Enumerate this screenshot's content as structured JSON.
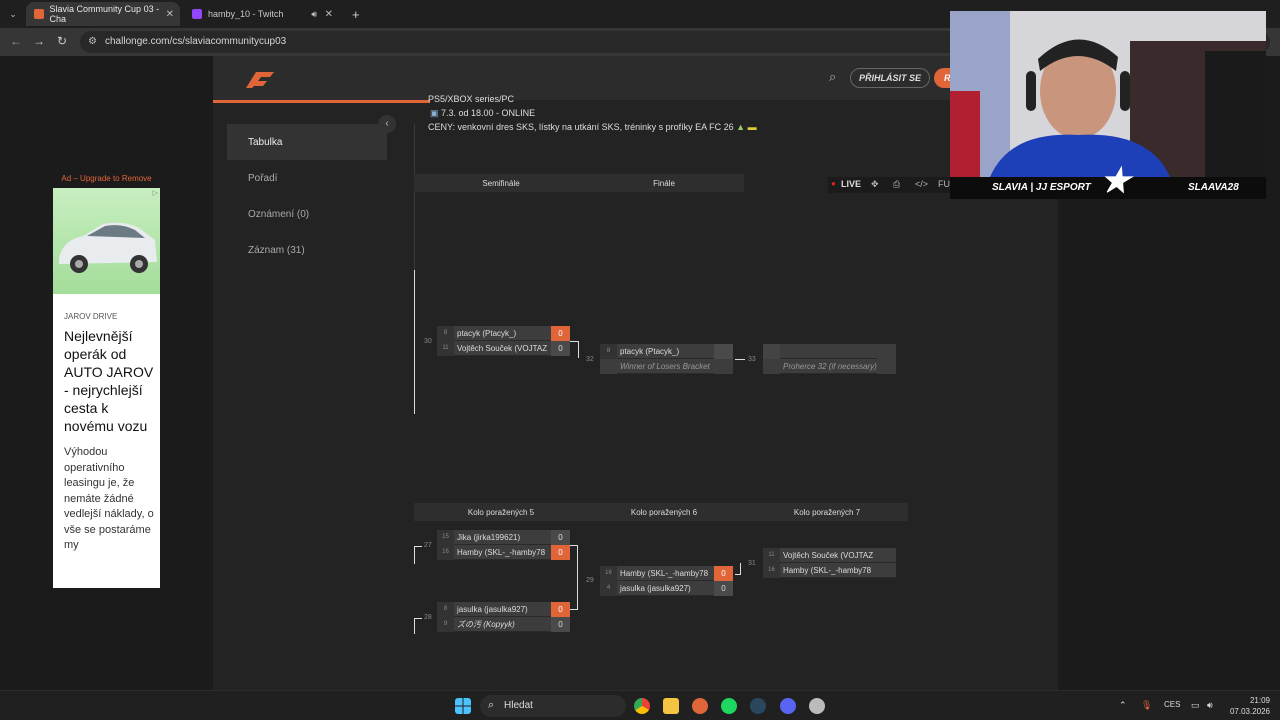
{
  "browser": {
    "tabs": [
      {
        "title": "Slavia Community Cup 03 - Cha"
      },
      {
        "title": "hamby_10 - Twitch"
      }
    ],
    "url": "challonge.com/cs/slaviacommunitycup03"
  },
  "site": {
    "login_label": "PŘIHLÁSIT SE",
    "register_label": "REGIS",
    "info_lines": [
      "PS5/XBOX series/PC",
      "7.3. od 18.00 - ONLINE",
      "CENY: venkovní dres SKS, lístky na utkání SKS, tréninky s profíky EA FC 26"
    ],
    "nav": [
      "Tabulka",
      "Pořadí",
      "Oznámení (0)",
      "Záznam (31)"
    ],
    "toolbar": {
      "live": "LIVE",
      "fullscreen": "FU"
    }
  },
  "ad": {
    "label": "Ad – Upgrade to Remove",
    "brand": "JAROV DRIVE",
    "headline": "Nejlevnější operák od AUTO JAROV - nejrychlejší cesta k novému vozu",
    "body": "Výhodou operativního leasingu je, že nemáte žádné vedlejší náklady, o vše se postaráme my"
  },
  "bracket": {
    "winners_rounds": [
      "Semifinále",
      "Finále"
    ],
    "losers_rounds": [
      "Kolo poražených 5",
      "Kolo poražených 6",
      "Kolo poražených 7"
    ],
    "matches": {
      "m30": {
        "num": "30",
        "p": [
          {
            "seed": "8",
            "name": "ptacyk (Ptacyk_)",
            "score": "0",
            "win": true
          },
          {
            "seed": "11",
            "name": "Vojtěch Souček (VOJTAZ",
            "score": "0",
            "win": false
          }
        ]
      },
      "m32": {
        "num": "32",
        "p": [
          {
            "seed": "8",
            "name": "ptacyk (Ptacyk_)",
            "score": "",
            "win": false
          },
          {
            "seed": "",
            "name": "Winner of Losers Bracket",
            "score": "",
            "win": false,
            "italic": true
          }
        ]
      },
      "m33": {
        "num": "33",
        "p": [
          {
            "seed": "",
            "name": "",
            "score": "",
            "win": false
          },
          {
            "seed": "",
            "name": "Proherce 32 (if necessary)",
            "score": "",
            "win": false,
            "italic": true
          }
        ]
      },
      "m27": {
        "num": "27",
        "p": [
          {
            "seed": "15",
            "name": "Jika (jirka199621)",
            "score": "0",
            "win": false
          },
          {
            "seed": "16",
            "name": "Hamby (SKL-_-hamby78",
            "score": "0",
            "win": true
          }
        ]
      },
      "m28": {
        "num": "28",
        "p": [
          {
            "seed": "8",
            "name": "jasulka (jasulka927)",
            "score": "0",
            "win": true
          },
          {
            "seed": "9",
            "name": "ズの汚 (Kopyyk)",
            "score": "0",
            "win": false
          }
        ]
      },
      "m29": {
        "num": "29",
        "p": [
          {
            "seed": "16",
            "name": "Hamby (SKL-_-hamby78",
            "score": "0",
            "win": true
          },
          {
            "seed": "4",
            "name": "jasulka (jasulka927)",
            "score": "0",
            "win": false
          }
        ]
      },
      "m31": {
        "num": "31",
        "p": [
          {
            "seed": "11",
            "name": "Vojtěch Souček (VOJTAZ",
            "score": "",
            "win": false
          },
          {
            "seed": "16",
            "name": "Hamby (SKL-_-hamby78",
            "score": "",
            "win": false
          }
        ]
      }
    }
  },
  "webcam": {
    "left_text": "SLAVIA | JJ ESPORT",
    "right_text": "SLAAVA28"
  },
  "taskbar": {
    "search": "Hledat",
    "lang": "CES",
    "time": "21:09",
    "date": "07.03.2026"
  },
  "colors": {
    "accent": "#e0663a"
  }
}
